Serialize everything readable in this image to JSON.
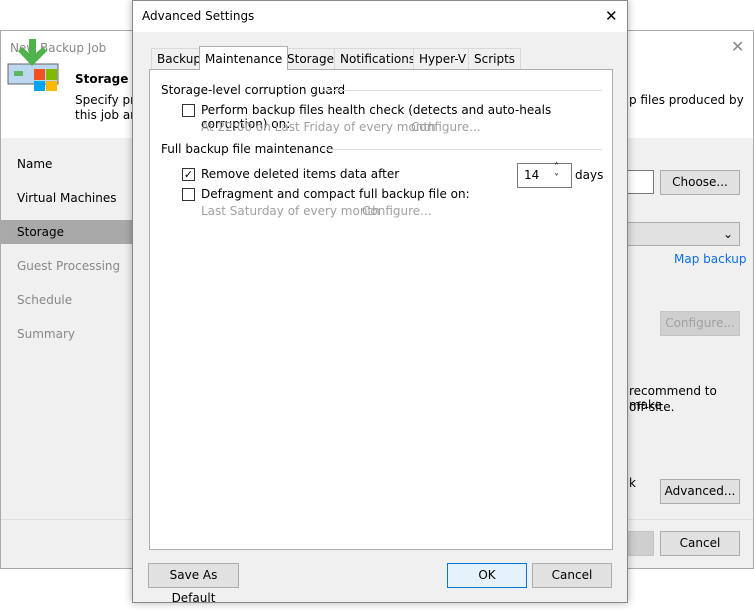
{
  "bg_window": {
    "title": "New Backup Job",
    "step_title": "Storage",
    "desc_line1_left": "Specify pro",
    "desc_line2_left": "this job and",
    "desc_right": "p files produced by",
    "nav": [
      {
        "label": "Name",
        "state": "normal"
      },
      {
        "label": "Virtual Machines",
        "state": "normal"
      },
      {
        "label": "Storage",
        "state": "selected"
      },
      {
        "label": "Guest Processing",
        "state": "disabled"
      },
      {
        "label": "Schedule",
        "state": "disabled"
      },
      {
        "label": "Summary",
        "state": "disabled"
      }
    ],
    "choose_label": "Choose...",
    "map_backup_label": "Map backup",
    "configure_label": "Configure...",
    "recommend_text1": "recommend to make",
    "recommend_text2": "off-site.",
    "partial_k": "k",
    "advanced_label": "Advanced...",
    "cancel_label": "Cancel"
  },
  "dialog": {
    "title": "Advanced Settings",
    "tabs": [
      "Backup",
      "Maintenance",
      "Storage",
      "Notifications",
      "Hyper-V",
      "Scripts"
    ],
    "active_tab": "Maintenance",
    "corruption_guard": {
      "heading": "Storage-level corruption guard",
      "health_check_label": "Perform backup files health check (detects and auto-heals corruption) on:",
      "health_check_checked": false,
      "health_schedule": "At 22:00 on Last Friday of every month",
      "health_configure": "Configure..."
    },
    "full_maintenance": {
      "heading": "Full backup file maintenance",
      "remove_label": "Remove deleted items data after",
      "remove_checked": true,
      "remove_days": "14",
      "days_label": "days",
      "defrag_label": "Defragment and compact full backup file on:",
      "defrag_checked": false,
      "defrag_schedule": "Last Saturday of every month",
      "defrag_configure": "Configure..."
    },
    "save_default_label": "Save As Default",
    "ok_label": "OK",
    "cancel_label": "Cancel"
  }
}
